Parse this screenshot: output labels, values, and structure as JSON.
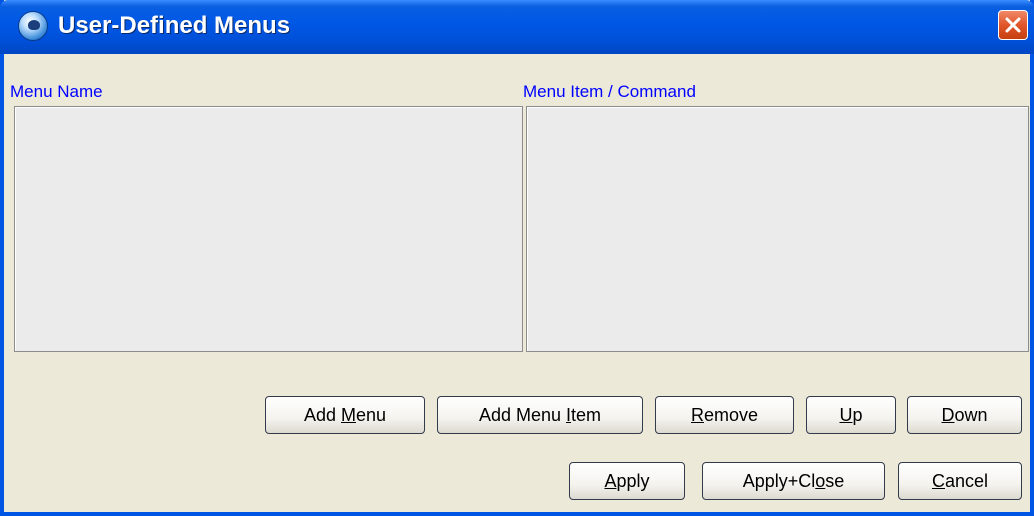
{
  "window": {
    "title": "User-Defined Menus"
  },
  "labels": {
    "menu_name": "Menu Name",
    "menu_item": "Menu Item / Command"
  },
  "buttons": {
    "add_menu": {
      "pre": "Add ",
      "mn": "M",
      "post": "enu"
    },
    "add_item": {
      "pre": "Add Menu ",
      "mn": "I",
      "post": "tem"
    },
    "remove": {
      "pre": "",
      "mn": "R",
      "post": "emove"
    },
    "up": {
      "pre": "",
      "mn": "U",
      "post": "p"
    },
    "down": {
      "pre": "",
      "mn": "D",
      "post": "own"
    },
    "apply": {
      "pre": "",
      "mn": "A",
      "post": "pply"
    },
    "apply_close": {
      "pre": "Apply+Cl",
      "mn": "o",
      "post": "se"
    },
    "cancel": {
      "pre": "",
      "mn": "C",
      "post": "ancel"
    }
  },
  "icons": {
    "app": "app-globe-icon",
    "close": "close-icon"
  },
  "colors": {
    "title_bar": "#0058e6",
    "label_text": "#0000ff",
    "close_button": "#e0552a",
    "dialog_bg": "#ece9d8"
  }
}
